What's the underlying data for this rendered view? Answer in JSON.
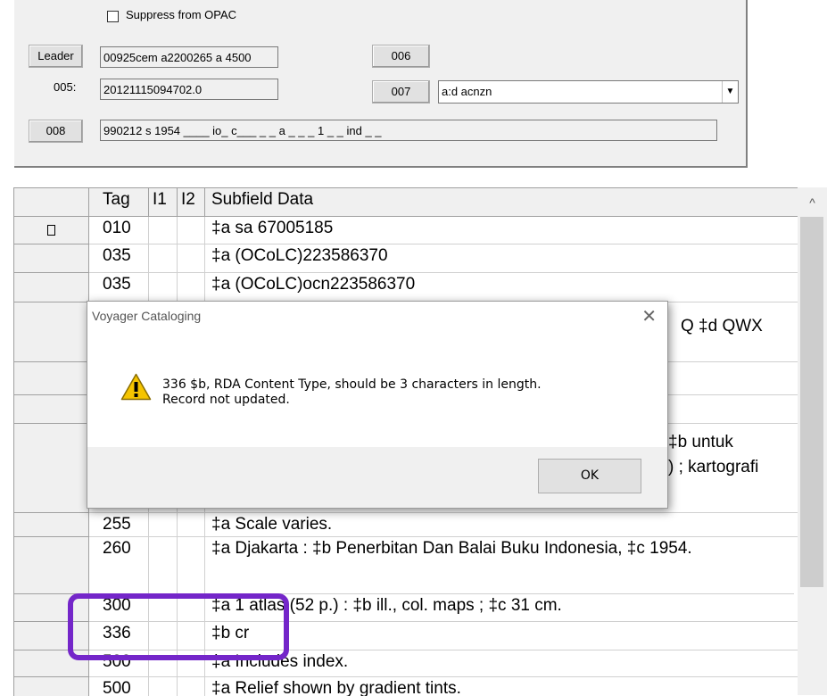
{
  "form": {
    "suppress_label": "Suppress from OPAC",
    "leader_button": "Leader",
    "leader_value": "00925cem a2200265 a 4500",
    "btn_006": "006",
    "label_005": "005:",
    "value_005": "20121115094702.0",
    "btn_007": "007",
    "value_007": "a:d acnzn",
    "btn_008": "008",
    "value_008": "990212 s 1954 ____ io_ c___ _ _ a _ _ _ 1 _ _ ind _ _"
  },
  "grid": {
    "headers": {
      "tag": "Tag",
      "i1": "I1",
      "i2": "I2",
      "data": "Subfield Data"
    },
    "rows": [
      {
        "tag": "010",
        "data": "‡a sa 67005185"
      },
      {
        "tag": "035",
        "data": "‡a (OCoLC)223586370"
      },
      {
        "tag": "035",
        "data": "‡a (OCoLC)ocn223586370"
      },
      {
        "tag": "",
        "data": "Q ‡d QWX"
      },
      {
        "tag": "",
        "data": "‡b untuk"
      },
      {
        "tag": "",
        "data": ") ; kartografi"
      },
      {
        "tag": "255",
        "data": "‡a Scale varies."
      },
      {
        "tag": "260",
        "data": "‡a Djakarta : ‡b Penerbitan Dan Balai Buku Indonesia, ‡c 1954."
      },
      {
        "tag": "300",
        "data": "‡a 1 atlas (52 p.) : ‡b ill., col. maps ; ‡c 31 cm."
      },
      {
        "tag": "336",
        "data": "‡b cr"
      },
      {
        "tag": "500",
        "data": "‡a Includes index."
      },
      {
        "tag": "500",
        "data": "‡a Relief shown by gradient tints."
      }
    ]
  },
  "dialog": {
    "title": "Voyager Cataloging",
    "message_line1": "336 $b, RDA Content Type, should be 3 characters in length.",
    "message_line2": "Record not updated.",
    "ok_label": "OK"
  },
  "colors": {
    "highlight": "#7426c9",
    "warning_yellow": "#f5c400"
  }
}
